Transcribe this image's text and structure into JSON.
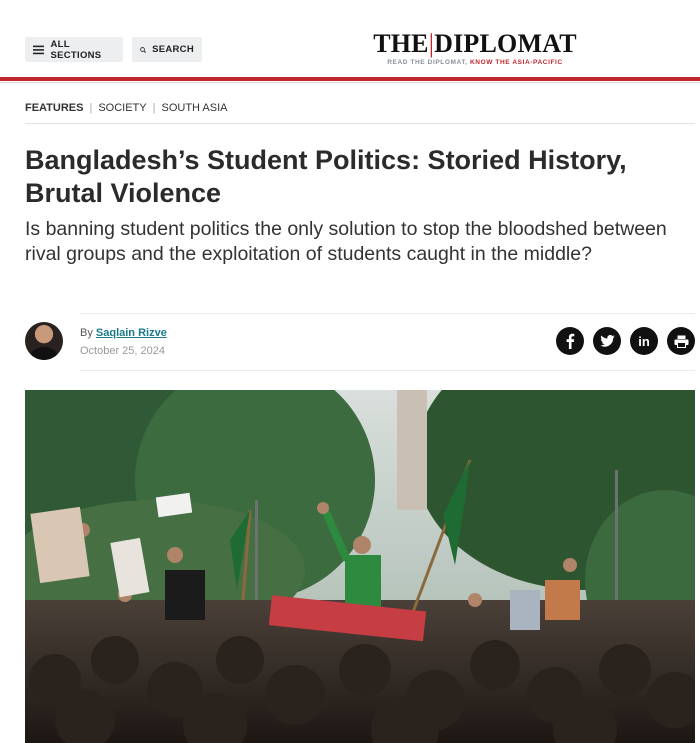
{
  "header": {
    "sections_label": "ALL SECTIONS",
    "search_label": "SEARCH",
    "logo_left": "THE",
    "logo_divider": "|",
    "logo_right": "DIPLOMAT",
    "tagline_gray": "READ THE DIPLOMAT,",
    "tagline_red": "KNOW THE ASIA-PACIFIC"
  },
  "breadcrumbs": [
    "FEATURES",
    "SOCIETY",
    "SOUTH ASIA"
  ],
  "breadcrumb_separator": "|",
  "article": {
    "title": "Bangladesh’s Student Politics: Storied History, Brutal Violence",
    "subtitle": "Is banning student politics the only solution to stop the bloodshed between rival groups and the exploitation of students caught in the middle?",
    "by_prefix": "By",
    "author": "Saqlain Rizve",
    "date": "October 25, 2024"
  },
  "share": {
    "facebook_icon": "f",
    "twitter_icon": "twitter-bird",
    "linkedin_icon": "in",
    "print_icon": "printer"
  },
  "colors": {
    "brand_red": "#c1272d",
    "author_link": "#1a7a8a"
  }
}
